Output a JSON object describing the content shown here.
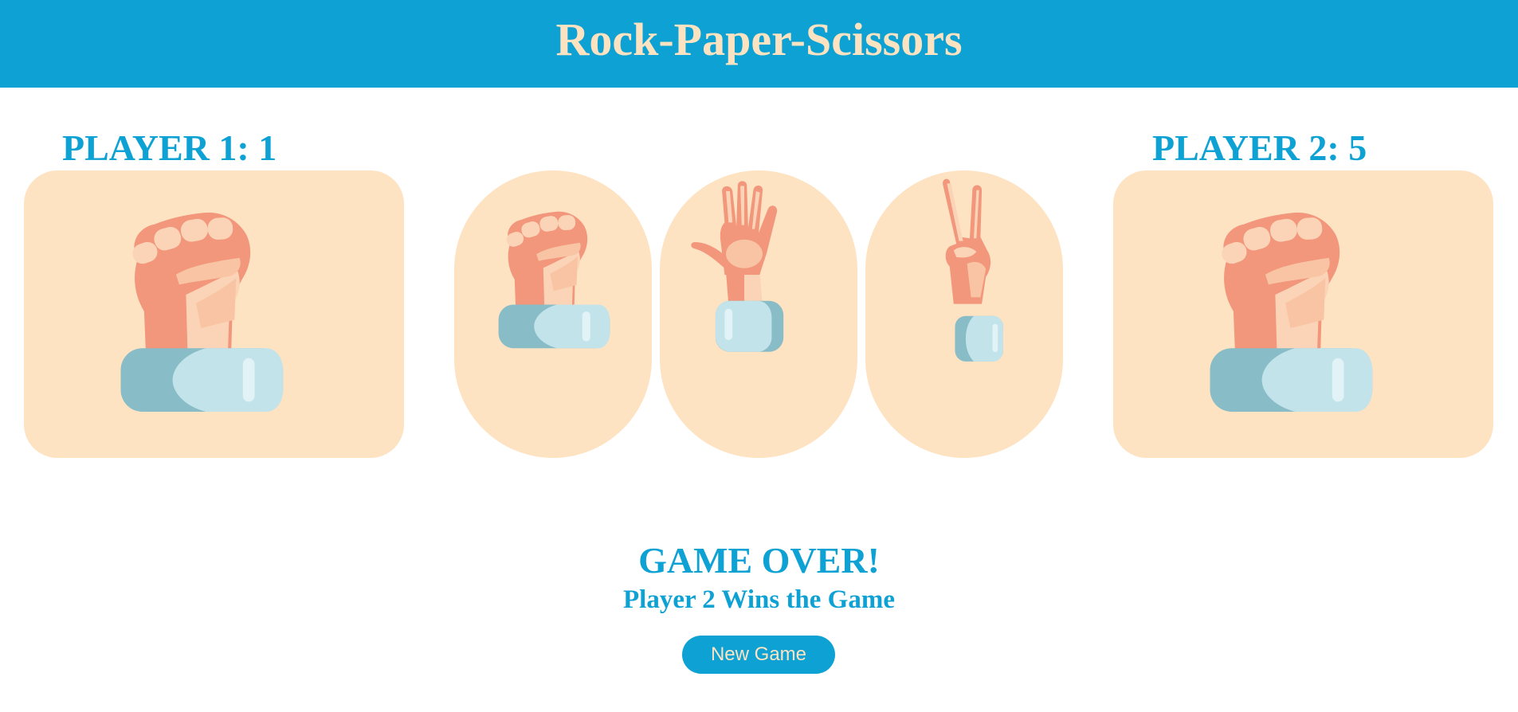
{
  "header": {
    "title": "Rock-Paper-Scissors"
  },
  "player1": {
    "label": "PLAYER 1:",
    "score": "1",
    "hand": "rock-hand-icon"
  },
  "player2": {
    "label": "PLAYER 2:",
    "score": "5",
    "hand": "rock-hand-icon"
  },
  "choices": [
    {
      "name": "rock",
      "icon": "rock-hand-icon"
    },
    {
      "name": "paper",
      "icon": "paper-hand-icon"
    },
    {
      "name": "scissors",
      "icon": "scissors-hand-icon"
    }
  ],
  "result": {
    "title": "GAME OVER!",
    "message": "Player 2 Wins the Game"
  },
  "actions": {
    "new_game_label": "New Game"
  },
  "colors": {
    "accent": "#0ea1d3",
    "header_text": "#fbe3c1",
    "card_bg": "#fee3c3",
    "skin_dark": "#f2967c",
    "skin_light": "#f9c4a3",
    "cuff_dark": "#88bcc7",
    "cuff_light": "#c3e3ea"
  }
}
